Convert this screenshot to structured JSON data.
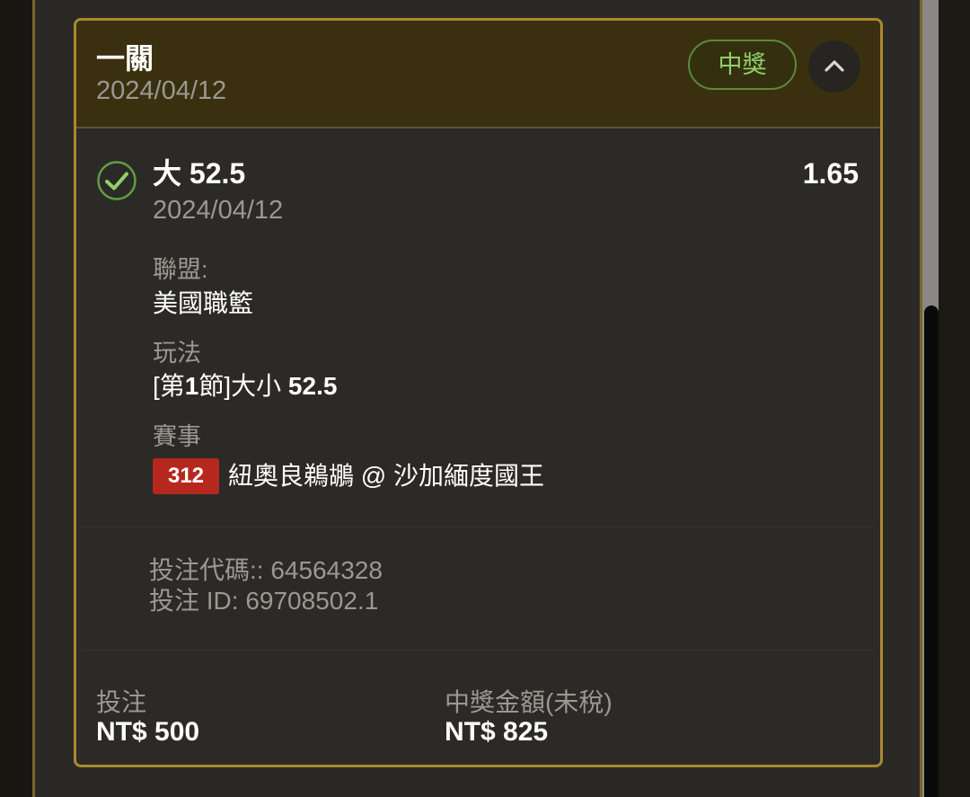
{
  "bet": {
    "type_label": "一關",
    "date": "2024/04/12",
    "status": "中獎"
  },
  "selection": {
    "title": "大 52.5",
    "odds": "1.65",
    "date": "2024/04/12"
  },
  "details": {
    "league_label": "聯盟:",
    "league_value": "美國職籃",
    "market_label": "玩法",
    "market_prefix": "[第",
    "market_period": "1",
    "market_suffix": "節]大小 ",
    "market_line": "52.5",
    "event_label": "賽事",
    "event_number": "312",
    "event_name": "紐奧良鵜鶘 @ 沙加緬度國王"
  },
  "codes": {
    "bet_code": "投注代碼:: 64564328",
    "bet_id": "投注 ID: 69708502.1"
  },
  "footer": {
    "stake_label": "投注",
    "stake_value": "NT$ 500",
    "payout_label": "中獎金額(未稅)",
    "payout_value": "NT$ 825"
  },
  "colors": {
    "card_border": "#a88930",
    "header_bg": "#3a3010",
    "status_green": "#8fcf6a",
    "badge_red": "#b6281e"
  },
  "icons": {
    "check": "check-circle-icon",
    "collapse": "chevron-up-icon"
  }
}
